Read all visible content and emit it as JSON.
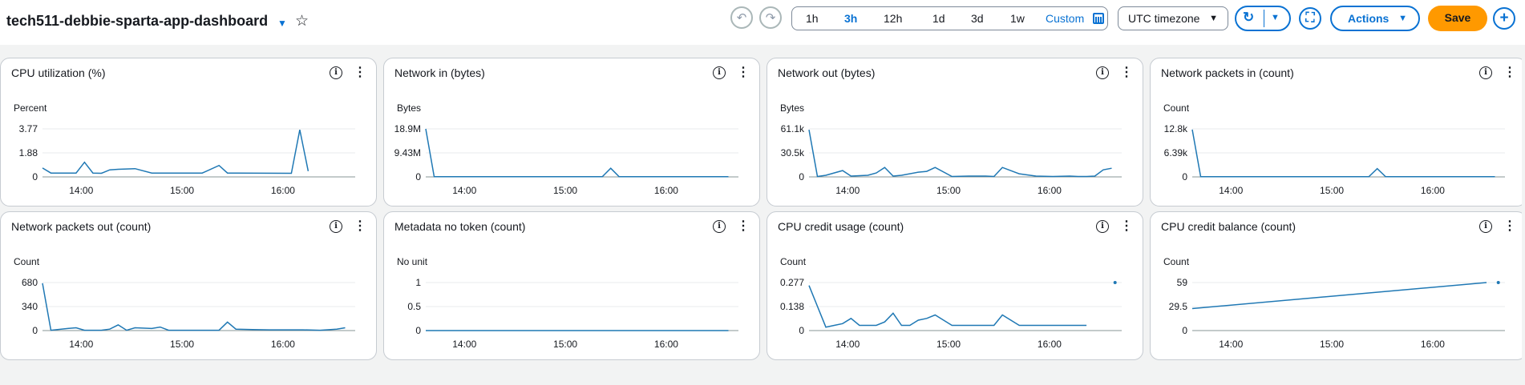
{
  "header": {
    "title": "tech511-debbie-sparta-app-dashboard",
    "title_caret": "▼",
    "star": "☆",
    "undo": "↶",
    "redo": "↷",
    "ranges": [
      "1h",
      "3h",
      "12h",
      "1d",
      "3d",
      "1w"
    ],
    "active_range": "3h",
    "custom_label": "Custom",
    "timezone": "UTC timezone",
    "caret": "▼",
    "refresh": "↻",
    "fullscreen": "⛶",
    "actions": "Actions",
    "save": "Save",
    "add": "+"
  },
  "colors": {
    "accent": "#0972d3",
    "save": "#ff9900",
    "series": "#1f78b4"
  },
  "widget_icons": {
    "info": "i",
    "menu": "⋮"
  },
  "widgets": [
    {
      "title": "CPU utilization (%)",
      "chart_data": {
        "type": "line",
        "unit": "Percent",
        "y_ticks": [
          "3.77",
          "1.88",
          "0"
        ],
        "ylim": [
          0,
          3.77
        ],
        "x_ticks": [
          "14:00",
          "15:00",
          "16:00"
        ],
        "xlim": [
          "13:37",
          "16:42"
        ],
        "series": [
          {
            "x": [
              "13:37",
              "13:42",
              "13:50",
              "13:57",
              "14:02",
              "14:07",
              "14:12",
              "14:17",
              "14:22",
              "14:32",
              "14:42",
              "14:47",
              "14:52",
              "15:02",
              "15:12",
              "15:22",
              "15:27",
              "15:32",
              "16:05",
              "16:10",
              "16:15"
            ],
            "y": [
              0.7,
              0.3,
              0.3,
              0.3,
              1.15,
              0.3,
              0.28,
              0.55,
              0.6,
              0.65,
              0.3,
              0.3,
              0.3,
              0.3,
              0.3,
              0.9,
              0.3,
              0.3,
              0.28,
              3.7,
              0.45
            ]
          }
        ],
        "points": []
      }
    },
    {
      "title": "Network in (bytes)",
      "chart_data": {
        "type": "line",
        "unit": "Bytes",
        "y_ticks": [
          "18.9M",
          "9.43M",
          "0"
        ],
        "ylim": [
          0,
          18.9
        ],
        "x_ticks": [
          "14:00",
          "15:00",
          "16:00"
        ],
        "xlim": [
          "13:37",
          "16:42"
        ],
        "series": [
          {
            "x": [
              "13:37",
              "13:42",
              "13:52",
              "14:02",
              "14:12",
              "14:22",
              "14:32",
              "14:42",
              "14:52",
              "15:02",
              "15:12",
              "15:22",
              "15:27",
              "15:32",
              "15:42",
              "15:52",
              "16:02",
              "16:12",
              "16:22",
              "16:32",
              "16:37"
            ],
            "y": [
              18.9,
              0.05,
              0.05,
              0.05,
              0.05,
              0.05,
              0.05,
              0.05,
              0.05,
              0.05,
              0.05,
              0.05,
              3.4,
              0.05,
              0.05,
              0.05,
              0.05,
              0.05,
              0.05,
              0.05,
              0.05
            ]
          }
        ],
        "points": []
      }
    },
    {
      "title": "Network out (bytes)",
      "chart_data": {
        "type": "line",
        "unit": "Bytes",
        "y_ticks": [
          "61.1k",
          "30.5k",
          "0"
        ],
        "ylim": [
          0,
          61.1
        ],
        "x_ticks": [
          "14:00",
          "15:00",
          "16:00"
        ],
        "xlim": [
          "13:37",
          "16:42"
        ],
        "series": [
          {
            "x": [
              "13:37",
              "13:42",
              "13:47",
              "13:57",
              "14:02",
              "14:12",
              "14:17",
              "14:22",
              "14:27",
              "14:32",
              "14:42",
              "14:47",
              "14:52",
              "15:02",
              "15:12",
              "15:22",
              "15:27",
              "15:32",
              "15:42",
              "15:52",
              "16:02",
              "16:12",
              "16:17",
              "16:22",
              "16:27",
              "16:32",
              "16:37"
            ],
            "y": [
              60,
              0.5,
              2,
              8,
              1,
              2,
              5,
              12,
              1,
              2,
              6,
              7,
              12,
              0.5,
              1,
              1,
              0.5,
              12,
              4,
              1,
              0.5,
              1,
              0.5,
              0.5,
              1,
              9,
              11
            ]
          }
        ],
        "points": []
      }
    },
    {
      "title": "Network packets in (count)",
      "chart_data": {
        "type": "line",
        "unit": "Count",
        "y_ticks": [
          "12.8k",
          "6.39k",
          "0"
        ],
        "ylim": [
          0,
          12.8
        ],
        "x_ticks": [
          "14:00",
          "15:00",
          "16:00"
        ],
        "xlim": [
          "13:37",
          "16:42"
        ],
        "series": [
          {
            "x": [
              "13:37",
              "13:42",
              "13:52",
              "14:02",
              "14:12",
              "14:22",
              "14:32",
              "14:42",
              "14:52",
              "15:02",
              "15:12",
              "15:22",
              "15:27",
              "15:32",
              "15:42",
              "15:52",
              "16:02",
              "16:12",
              "16:22",
              "16:32",
              "16:37"
            ],
            "y": [
              12.6,
              0.05,
              0.05,
              0.05,
              0.05,
              0.05,
              0.05,
              0.05,
              0.05,
              0.05,
              0.05,
              0.05,
              2.2,
              0.05,
              0.05,
              0.05,
              0.05,
              0.05,
              0.05,
              0.05,
              0.05
            ]
          }
        ],
        "points": []
      }
    },
    {
      "title": "Network packets out (count)",
      "chart_data": {
        "type": "line",
        "unit": "Count",
        "y_ticks": [
          "680",
          "340",
          "0"
        ],
        "ylim": [
          0,
          680
        ],
        "x_ticks": [
          "14:00",
          "15:00",
          "16:00"
        ],
        "xlim": [
          "13:37",
          "16:42"
        ],
        "series": [
          {
            "x": [
              "13:37",
              "13:42",
              "13:52",
              "13:57",
              "14:02",
              "14:07",
              "14:12",
              "14:17",
              "14:22",
              "14:27",
              "14:32",
              "14:42",
              "14:47",
              "14:52",
              "15:02",
              "15:12",
              "15:22",
              "15:27",
              "15:32",
              "15:42",
              "15:52",
              "16:02",
              "16:12",
              "16:22",
              "16:32",
              "16:37"
            ],
            "y": [
              670,
              5,
              30,
              40,
              5,
              5,
              5,
              20,
              80,
              5,
              40,
              30,
              50,
              5,
              5,
              5,
              5,
              120,
              20,
              15,
              10,
              10,
              10,
              5,
              20,
              40
            ]
          }
        ],
        "points": []
      }
    },
    {
      "title": "Metadata no token (count)",
      "chart_data": {
        "type": "line",
        "unit": "No unit",
        "y_ticks": [
          "1",
          "0.5",
          "0"
        ],
        "ylim": [
          0,
          1
        ],
        "x_ticks": [
          "14:00",
          "15:00",
          "16:00"
        ],
        "xlim": [
          "13:37",
          "16:42"
        ],
        "series": [
          {
            "x": [
              "13:37",
              "16:37"
            ],
            "y": [
              0,
              0
            ]
          }
        ],
        "points": []
      }
    },
    {
      "title": "CPU credit usage (count)",
      "chart_data": {
        "type": "line",
        "unit": "Count",
        "y_ticks": [
          "0.277",
          "0.138",
          "0"
        ],
        "ylim": [
          0,
          0.277
        ],
        "x_ticks": [
          "14:00",
          "15:00",
          "16:00"
        ],
        "xlim": [
          "13:37",
          "16:42"
        ],
        "series": [
          {
            "x": [
              "13:37",
              "13:47",
              "13:52",
              "13:57",
              "14:02",
              "14:07",
              "14:12",
              "14:17",
              "14:22",
              "14:27",
              "14:32",
              "14:37",
              "14:42",
              "14:47",
              "14:52",
              "14:57",
              "15:02",
              "15:12",
              "15:22",
              "15:27",
              "15:32",
              "15:42",
              "15:52",
              "16:02",
              "16:12",
              "16:22"
            ],
            "y": [
              0.26,
              0.02,
              0.03,
              0.04,
              0.07,
              0.03,
              0.03,
              0.03,
              0.05,
              0.1,
              0.03,
              0.03,
              0.06,
              0.07,
              0.09,
              0.06,
              0.03,
              0.03,
              0.03,
              0.03,
              0.09,
              0.03,
              0.03,
              0.03,
              0.03,
              0.03
            ]
          }
        ],
        "points": [
          {
            "x": "16:39",
            "y": 0.277
          }
        ]
      }
    },
    {
      "title": "CPU credit balance (count)",
      "chart_data": {
        "type": "line",
        "unit": "Count",
        "y_ticks": [
          "59",
          "29.5",
          "0"
        ],
        "ylim": [
          0,
          59
        ],
        "x_ticks": [
          "14:00",
          "15:00",
          "16:00"
        ],
        "xlim": [
          "13:37",
          "16:42"
        ],
        "series": [
          {
            "x": [
              "13:37",
              "16:32"
            ],
            "y": [
              27,
              59
            ]
          }
        ],
        "points": [
          {
            "x": "16:39",
            "y": 59
          }
        ]
      }
    }
  ]
}
